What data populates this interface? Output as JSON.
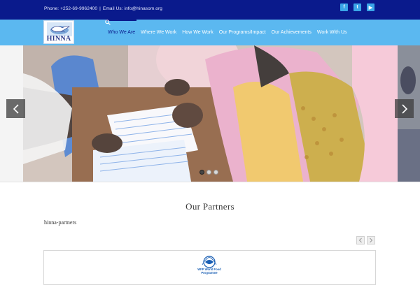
{
  "topbar": {
    "phone": "Phone: +252-69-9962400",
    "separator": "|",
    "email": "Email Us: info@hinasom.org",
    "social": [
      {
        "icon": "facebook-icon",
        "glyph": "f"
      },
      {
        "icon": "twitter-icon",
        "glyph": "t"
      },
      {
        "icon": "youtube-icon",
        "glyph": "▶"
      }
    ]
  },
  "logo": {
    "text": "HINNA"
  },
  "nav": {
    "items": [
      {
        "label": "Who We Are",
        "active": true
      },
      {
        "label": "Where We Work",
        "active": false
      },
      {
        "label": "How We Work",
        "active": false
      },
      {
        "label": "Our Programs/Impact",
        "active": false
      },
      {
        "label": "Our Achievements",
        "active": false
      },
      {
        "label": "Work With Us",
        "active": false
      }
    ],
    "search_icon": "search-icon"
  },
  "slider": {
    "prev_icon": "chevron-left-icon",
    "next_icon": "chevron-right-icon",
    "slide_count": 3,
    "active_slide": 1
  },
  "partners": {
    "title": "Our Partners",
    "subtitle": "hinna-partners",
    "prev_icon": "chevron-left-icon",
    "next_icon": "chevron-right-icon",
    "logo_text": "WFP World Food Programme"
  },
  "colors": {
    "topbar": "#0a1a8c",
    "navbar": "#5bb8f0",
    "accent": "#0a1a8c",
    "social": "#3aa6e8"
  }
}
